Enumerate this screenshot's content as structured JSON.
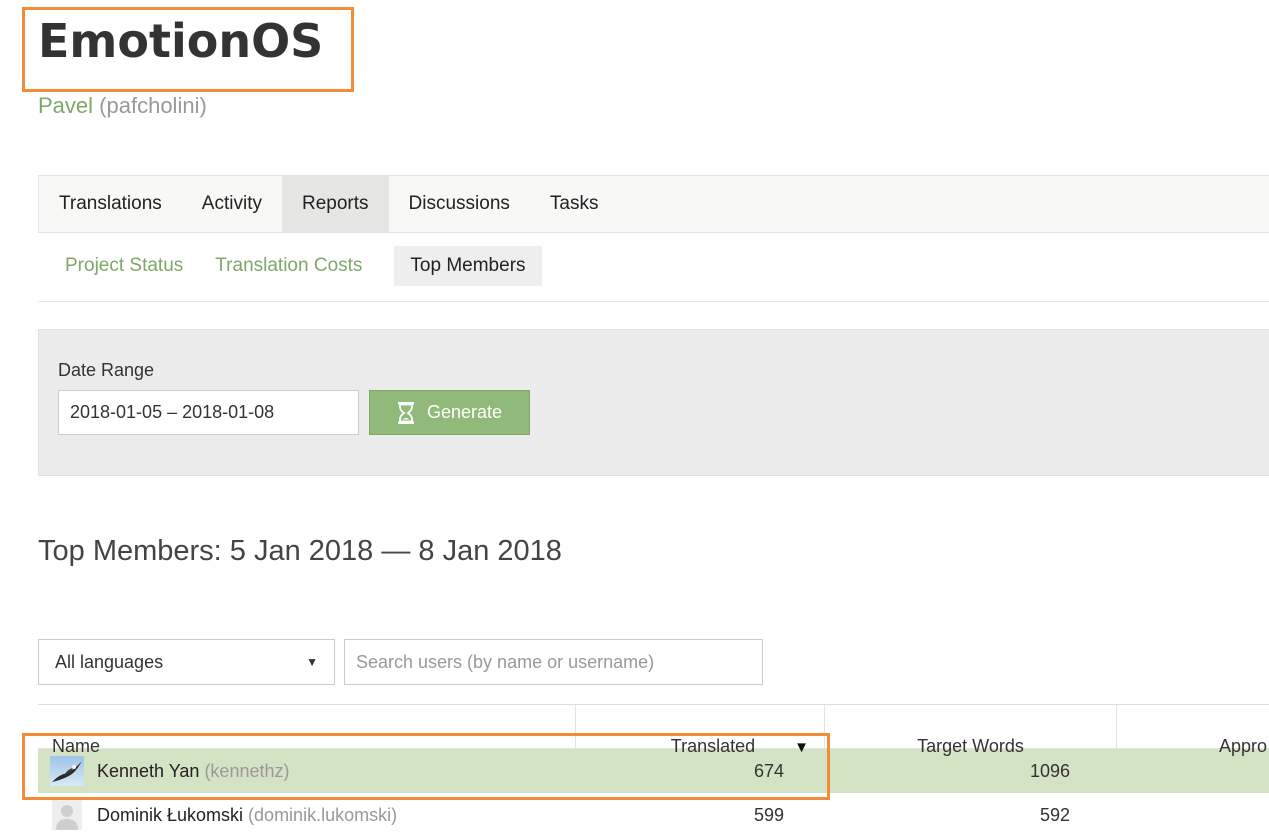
{
  "project": {
    "title": "EmotionOS",
    "owner_name": "Pavel",
    "owner_username": "(pafcholini)"
  },
  "main_tabs": [
    {
      "label": "Translations",
      "active": false
    },
    {
      "label": "Activity",
      "active": false
    },
    {
      "label": "Reports",
      "active": true
    },
    {
      "label": "Discussions",
      "active": false
    },
    {
      "label": "Tasks",
      "active": false
    }
  ],
  "sub_tabs": [
    {
      "label": "Project Status",
      "active": false
    },
    {
      "label": "Translation Costs",
      "active": false
    },
    {
      "label": "Top Members",
      "active": true
    }
  ],
  "filter": {
    "date_label": "Date Range",
    "date_value": "2018-01-05 – 2018-01-08",
    "generate_label": "Generate"
  },
  "report": {
    "heading": "Top Members: 5 Jan 2018 — 8 Jan 2018",
    "language_select": "All languages",
    "search_placeholder": "Search users (by name or username)"
  },
  "table": {
    "headers": {
      "name": "Name",
      "translated": "Translated",
      "target_words": "Target Words",
      "approved": "Appro"
    },
    "sort_indicator": "▼",
    "rows": [
      {
        "name": "Kenneth Yan",
        "username": "(kennethz)",
        "translated": "674",
        "target_words": "1096",
        "highlighted": true
      },
      {
        "name": "Dominik Łukomski",
        "username": "(dominik.lukomski)",
        "translated": "599",
        "target_words": "592",
        "highlighted": false
      }
    ]
  },
  "colors": {
    "accent_green": "#7fa868",
    "button_green": "#91b97a",
    "row_highlight": "#d5e3c5",
    "annotation_orange": "#f28c38"
  }
}
